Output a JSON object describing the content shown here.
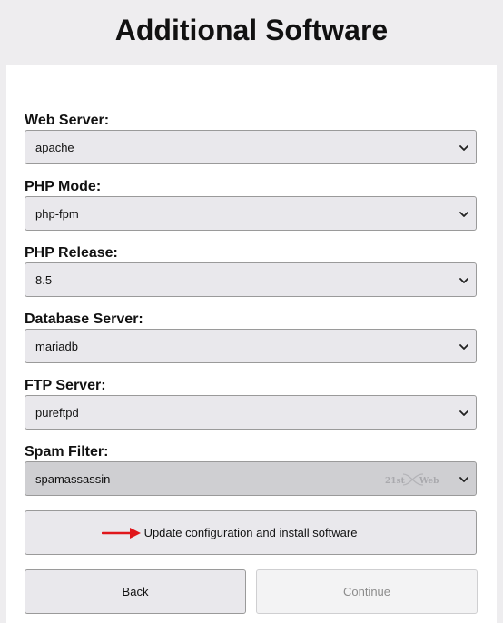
{
  "header": {
    "title": "Additional Software"
  },
  "fields": [
    {
      "label": "Web Server:",
      "value": "apache",
      "enabled": true
    },
    {
      "label": "PHP Mode:",
      "value": "php-fpm",
      "enabled": true
    },
    {
      "label": "PHP Release:",
      "value": "8.5",
      "enabled": true
    },
    {
      "label": "Database Server:",
      "value": "mariadb",
      "enabled": true
    },
    {
      "label": "FTP Server:",
      "value": "pureftpd",
      "enabled": true
    },
    {
      "label": "Spam Filter:",
      "value": "spamassassin",
      "enabled": false
    }
  ],
  "watermark": {
    "text_left": "21st",
    "text_right": "Web"
  },
  "actions": {
    "update_label": "Update configuration and install software",
    "back_label": "Back",
    "continue_label": "Continue"
  },
  "colors": {
    "arrow": "#e0161b",
    "select_bg": "#e9e8ec",
    "select_disabled_bg": "#cfcfd2"
  }
}
